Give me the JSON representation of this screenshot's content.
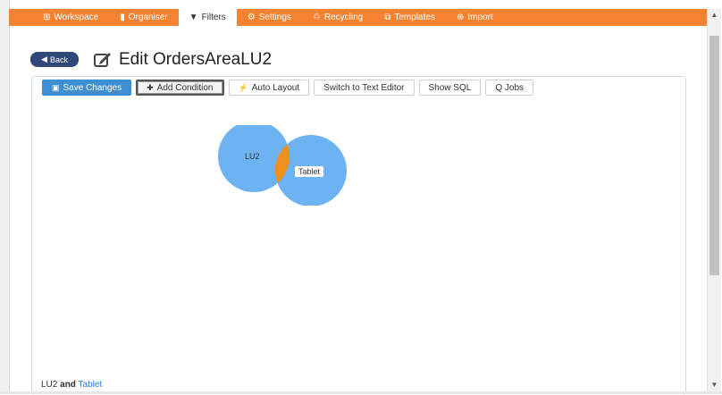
{
  "nav": {
    "items": [
      {
        "icon": "workspace-icon",
        "glyph": "⊞",
        "label": "Workspace"
      },
      {
        "icon": "organiser-icon",
        "glyph": "▮",
        "label": "Organiser"
      },
      {
        "icon": "filter-icon",
        "glyph": "▼",
        "label": "Filters",
        "active": true
      },
      {
        "icon": "settings-icon",
        "glyph": "⚙",
        "label": "Settings"
      },
      {
        "icon": "recycling-icon",
        "glyph": "♲",
        "label": "Recycling"
      },
      {
        "icon": "templates-icon",
        "glyph": "⧉",
        "label": "Templates"
      },
      {
        "icon": "import-icon",
        "glyph": "⊕",
        "label": "Import"
      }
    ],
    "accent": "#f58231"
  },
  "header": {
    "back_label": "Back",
    "title": "Edit OrdersAreaLU2"
  },
  "toolbar": {
    "save_label": "Save Changes",
    "add_condition_label": "Add Condition",
    "auto_layout_label": "Auto Layout",
    "text_editor_label": "Switch to Text Editor",
    "show_sql_label": "Show SQL",
    "q_jobs_label": "Q Jobs"
  },
  "venn": {
    "set_a": "LU2",
    "set_b": "Tablet",
    "circle_color": "#6db3f2",
    "intersection_color": "#f0901e"
  },
  "footer": {
    "left": "LU2",
    "joiner": "and",
    "right": "Tablet"
  }
}
